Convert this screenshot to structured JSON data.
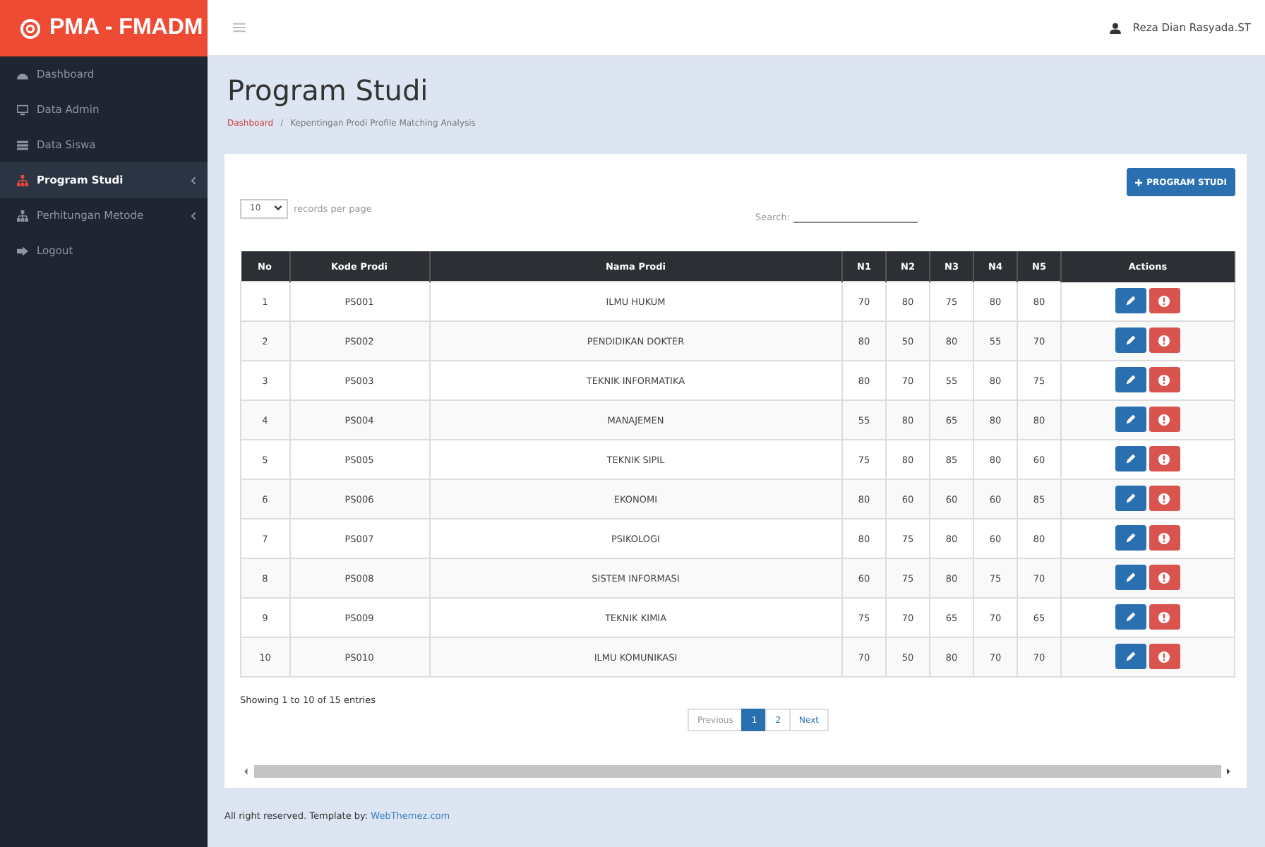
{
  "brand": {
    "title": "PMA - FMADM"
  },
  "user": {
    "name": "Reza Dian Rasyada.ST"
  },
  "sidebar": {
    "items": [
      {
        "label": "Dashboard",
        "selected": false,
        "has_submenu": false
      },
      {
        "label": "Data Admin",
        "selected": false,
        "has_submenu": false
      },
      {
        "label": "Data Siswa",
        "selected": false,
        "has_submenu": false
      },
      {
        "label": "Program Studi",
        "selected": true,
        "has_submenu": true
      },
      {
        "label": "Perhitungan Metode",
        "selected": false,
        "has_submenu": true
      },
      {
        "label": "Logout",
        "selected": false,
        "has_submenu": false
      }
    ]
  },
  "page": {
    "title": "Program Studi",
    "breadcrumb": {
      "items": [
        "Dashboard",
        "Kepentingan Prodi Profile Matching Analysis"
      ],
      "separator": "/"
    }
  },
  "add_button": {
    "label": "PROGRAM STUDI"
  },
  "page_size": {
    "value": "10",
    "label": "records per page"
  },
  "search": {
    "label": "Search:"
  },
  "table": {
    "columns": [
      "No",
      "Kode Prodi",
      "Nama Prodi",
      "N1",
      "N2",
      "N3",
      "N4",
      "N5",
      "Actions"
    ],
    "rows": [
      [
        "1",
        "PS001",
        "ILMU HUKUM",
        "70",
        "80",
        "75",
        "80",
        "80"
      ],
      [
        "2",
        "PS002",
        "PENDIDIKAN DOKTER",
        "80",
        "50",
        "80",
        "55",
        "70"
      ],
      [
        "3",
        "PS003",
        "TEKNIK INFORMATIKA",
        "80",
        "70",
        "55",
        "80",
        "75"
      ],
      [
        "4",
        "PS004",
        "MANAJEMEN",
        "55",
        "80",
        "65",
        "80",
        "80"
      ],
      [
        "5",
        "PS005",
        "TEKNIK SIPIL",
        "75",
        "80",
        "85",
        "80",
        "60"
      ],
      [
        "6",
        "PS006",
        "EKONOMI",
        "80",
        "60",
        "60",
        "60",
        "85"
      ],
      [
        "7",
        "PS007",
        "PSIKOLOGI",
        "80",
        "75",
        "80",
        "60",
        "80"
      ],
      [
        "8",
        "PS008",
        "SISTEM INFORMASI",
        "60",
        "75",
        "80",
        "75",
        "70"
      ],
      [
        "9",
        "PS009",
        "TEKNIK KIMIA",
        "75",
        "70",
        "65",
        "70",
        "65"
      ],
      [
        "10",
        "PS010",
        "ILMU KOMUNIKASI",
        "70",
        "50",
        "80",
        "70",
        "70"
      ]
    ]
  },
  "info": "Showing 1 to 10 of 15 entries",
  "pagination": {
    "previous": "Previous",
    "next": "Next",
    "pages": [
      {
        "label": "1",
        "selected": true
      },
      {
        "label": "2",
        "selected": false
      }
    ]
  },
  "footer": {
    "text": "All right reserved. Template by:",
    "link": "WebThemez.com"
  }
}
